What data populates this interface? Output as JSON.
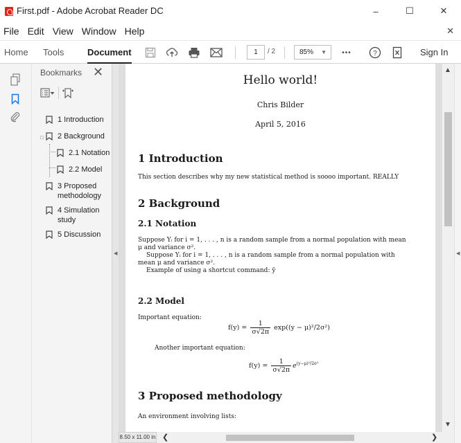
{
  "window": {
    "title": "First.pdf - Adobe Acrobat Reader DC",
    "minimize": "–",
    "maximize": "☐",
    "close": "✕"
  },
  "menu": {
    "items": [
      "File",
      "Edit",
      "View",
      "Window",
      "Help"
    ],
    "close": "✕"
  },
  "toolbar": {
    "tabs": [
      "Home",
      "Tools",
      "Document"
    ],
    "active_tab": "Document",
    "page_current": "1",
    "page_total": "/ 2",
    "zoom": "85%",
    "more": "•••",
    "help": "?",
    "sign_in": "Sign In"
  },
  "bookmarks": {
    "title": "Bookmarks",
    "close": "✕",
    "items": [
      {
        "label": "1 Introduction",
        "level": 0
      },
      {
        "label": "2 Background",
        "level": 0
      },
      {
        "label": "2.1 Notation",
        "level": 1
      },
      {
        "label": "2.2 Model",
        "level": 1
      },
      {
        "label": "3 Proposed methodology",
        "line1": "3 Proposed",
        "line2": "methodology",
        "level": 0
      },
      {
        "label": "4 Simulation study",
        "line1": "4 Simulation",
        "line2": "study",
        "level": 0
      },
      {
        "label": "5 Discussion",
        "level": 0
      }
    ]
  },
  "document": {
    "title": "Hello world!",
    "author": "Chris Bilder",
    "date": "April 5, 2016",
    "sec1": "1   Introduction",
    "sec1_text": "This section describes why my new statistical method is soooo important. REALLY",
    "sec2": "2   Background",
    "sub21": "2.1   Notation",
    "p1_line1": "Suppose Yᵢ for i = 1, . . . , n is a random sample from a normal population with mean",
    "p1_line2": "μ and variance σ².",
    "p2_line1": "Suppose Yᵢ for i = 1, . . . , n is a random sample from a normal population with",
    "p2_line2": "mean μ and variance σ².",
    "p3": "Example of using a shortcut command: ȳ",
    "sub22": "2.2   Model",
    "important": "Important equation:",
    "eq1_left": "f(y) =",
    "eq1_num": "1",
    "eq1_den": "σ√2π",
    "eq1_right": "exp((y − μ)²/2σ²)",
    "another": "Another important equation:",
    "eq2_left": "f(y) =",
    "eq2_num": "1",
    "eq2_den": "σ√2π",
    "eq2_exp": "(y−μ)²/2σ²",
    "sec3": "3   Proposed methodology",
    "sec3_text": "An environment involving lists:"
  },
  "status": {
    "page_size": "8.50 x 11.00 in"
  }
}
